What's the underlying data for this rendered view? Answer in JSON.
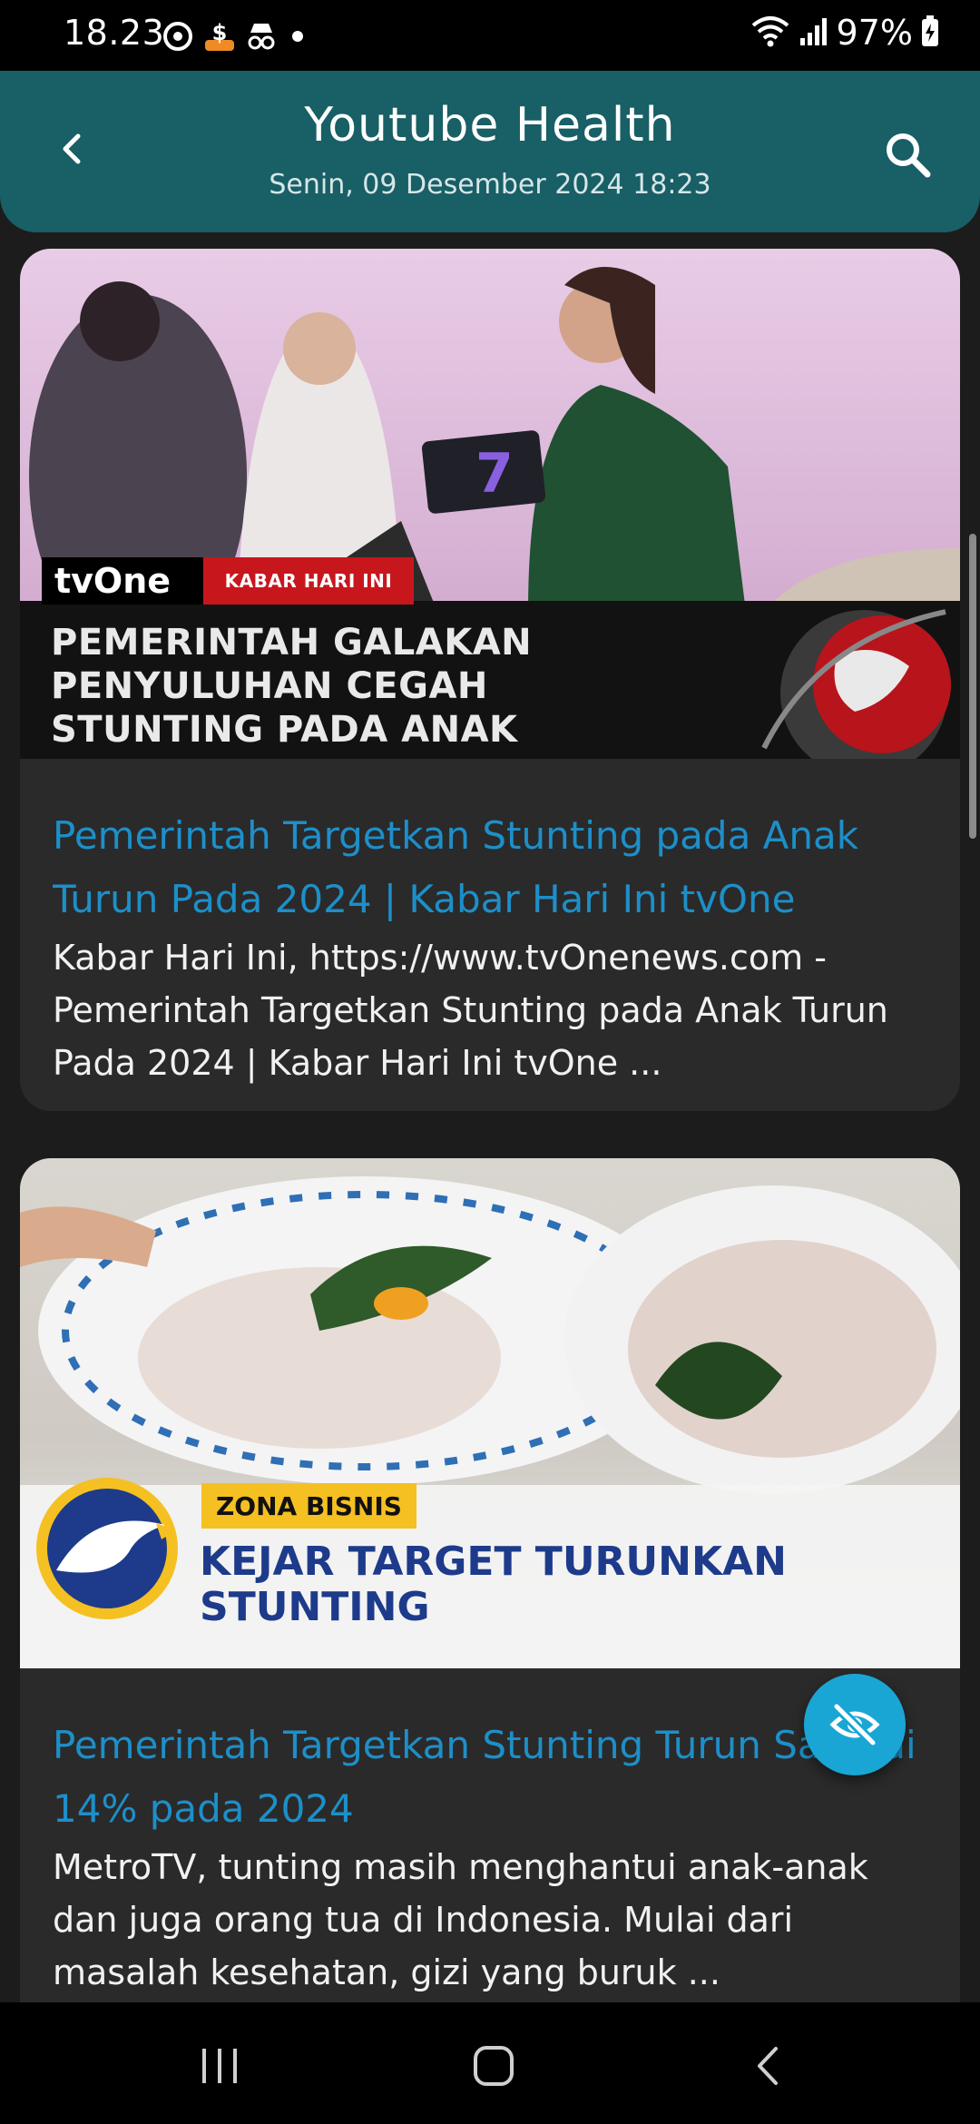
{
  "status_bar": {
    "time": "18.23",
    "battery": "97%"
  },
  "header": {
    "title": "Youtube Health",
    "subtitle": "Senin, 09 Desember 2024 18:23"
  },
  "videos": [
    {
      "thumbnail": {
        "channel_logo": "tvOne",
        "tag": "KABAR HARI INI",
        "headline_lines": [
          "PEMERINTAH GALAKAN",
          "PENYULUHAN CEGAH",
          "STUNTING PADA ANAK"
        ]
      },
      "title": "Pemerintah Targetkan Stunting pada Anak Turun Pada 2024 | Kabar Hari Ini tvOne",
      "description": "Kabar Hari Ini, https://www.tvOnenews.com - Pemerintah Targetkan Stunting pada Anak Turun Pada 2024 | Kabar Hari Ini tvOne ..."
    },
    {
      "thumbnail": {
        "tag": "ZONA BISNIS",
        "headline_lines": [
          "KEJAR TARGET TURUNKAN",
          "STUNTING"
        ]
      },
      "title": "Pemerintah Targetkan Stunting Turun Sampai 14% pada 2024",
      "description": "MetroTV, tunting masih menghantui anak-anak dan juga orang tua di Indonesia. Mulai dari masalah kesehatan, gizi yang buruk ..."
    }
  ],
  "colors": {
    "header_bg": "#185f66",
    "title_link": "#1d8fc9",
    "fab": "#1aa6d4"
  },
  "icons": {
    "back": "back-arrow-icon",
    "search": "search-icon",
    "fab": "eye-off-icon"
  }
}
